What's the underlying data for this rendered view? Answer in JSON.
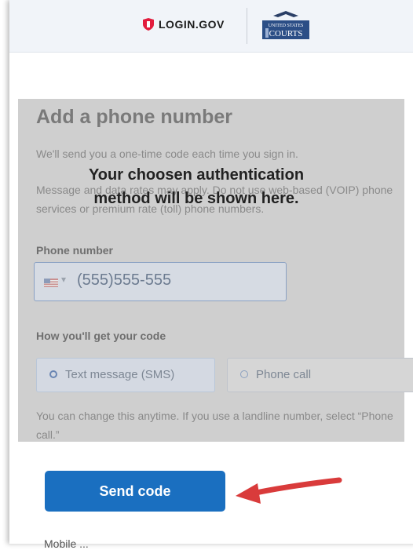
{
  "header": {
    "login_logo_text": "LOGIN.GOV",
    "courts_logo_small": "UNITED STATES",
    "courts_logo_big": "COURTS"
  },
  "form": {
    "title": "Add a phone number",
    "intro": "We'll send you a one-time code each time you sign in.",
    "rates_text": "Message and data rates may apply. Do not use web-based (VOIP) phone services or premium rate (toll) phone numbers.",
    "phone_label": "Phone number",
    "phone_value": "(555)555-555",
    "how_label": "How you'll get your code",
    "options": [
      {
        "label": "Text message (SMS)"
      },
      {
        "label": "Phone call"
      }
    ],
    "change_text": "You can change this anytime. If you use a landline number, select “Phone call.”",
    "send_button": "Send code",
    "bottom_text": "Mobile ..."
  },
  "overlay": {
    "line1": "Your choosen authentication",
    "line2": "method will be shown here."
  },
  "colors": {
    "primary": "#1a6fc0",
    "annotation_arrow": "#d93b3b",
    "overlay": "#cfcfcf"
  }
}
